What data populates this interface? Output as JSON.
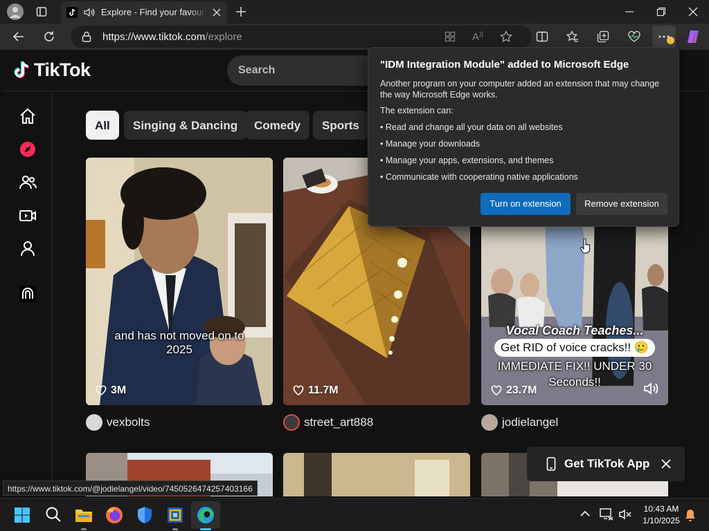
{
  "browser": {
    "tab_title": "Explore - Find your favourite videos on TikTok",
    "url_domain": "https://www.tiktok.com",
    "url_path": "/explore"
  },
  "tiktok": {
    "logo": "TikTok",
    "search_placeholder": "Search",
    "categories": [
      "All",
      "Singing & Dancing",
      "Comedy",
      "Sports"
    ],
    "videos": [
      {
        "caption": "and has not moved on to 2025",
        "likes": "3M",
        "author": "vexbolts"
      },
      {
        "caption": "",
        "likes": "11.7M",
        "author": "street_art888"
      },
      {
        "caption_title": "Vocal Coach Teaches...",
        "caption_bubble": "Get RID of voice cracks!! 🥲",
        "caption_extra": "IMMEDIATE FIX!! UNDER 30 Seconds!!",
        "likes": "23.7M",
        "author": "jodielangel"
      }
    ],
    "get_app": "Get TikTok App"
  },
  "popup": {
    "title": "\"IDM Integration Module\" added to Microsoft Edge",
    "description": "Another program on your computer added an extension that may change the way Microsoft Edge works.",
    "can_label": "The extension can:",
    "permissions": [
      "• Read and change all your data on all websites",
      "• Manage your downloads",
      "• Manage your apps, extensions, and themes",
      "• Communicate with cooperating native applications"
    ],
    "primary_button": "Turn on extension",
    "secondary_button": "Remove extension"
  },
  "status_bar_url": "https://www.tiktok.com/@jodielangel/video/7450526474257403166",
  "taskbar": {
    "time": "10:43 AM",
    "date": "1/10/2025"
  },
  "colors": {
    "tiktok_red": "#fe2c55",
    "tiktok_cyan": "#25f4ee",
    "edge_blue": "#0f6cbd"
  }
}
